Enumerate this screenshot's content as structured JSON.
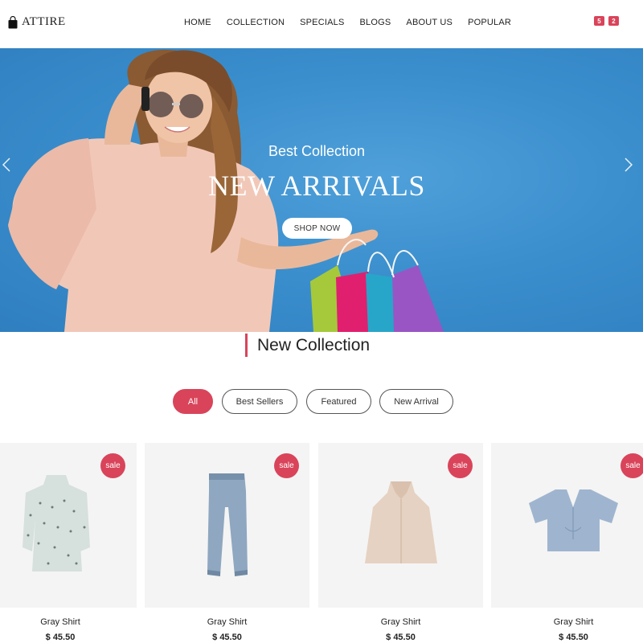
{
  "header": {
    "logo_text": "ATTIRE",
    "logo_icon": "shopping-bag-icon",
    "nav": [
      "HOME",
      "COLLECTION",
      "SPECIALS",
      "BLOGS",
      "ABOUT US",
      "POPULAR"
    ],
    "badges": [
      "5",
      "2"
    ]
  },
  "hero": {
    "subtitle": "Best Collection",
    "title": "NEW ARRIVALS",
    "button": "SHOP NOW",
    "prev_icon": "chevron-left-icon",
    "next_icon": "chevron-right-icon"
  },
  "section": {
    "title": "New Collection"
  },
  "filters": [
    "All",
    "Best Sellers",
    "Featured",
    "New Arrival"
  ],
  "products": [
    {
      "name": "Gray Shirt",
      "price": "$ 45.50",
      "badge": "sale",
      "image": "polka-dot-dress"
    },
    {
      "name": "Gray Shirt",
      "price": "$ 45.50",
      "badge": "sale",
      "image": "denim-jeans"
    },
    {
      "name": "Gray Shirt",
      "price": "$ 45.50",
      "badge": "sale",
      "image": "beige-halter-top"
    },
    {
      "name": "Gray Shirt",
      "price": "$ 45.50",
      "badge": "sale",
      "image": "blue-ruched-crop-top"
    }
  ],
  "colors": {
    "accent": "#d9445a",
    "hero_bg": "#3b8fcd"
  }
}
